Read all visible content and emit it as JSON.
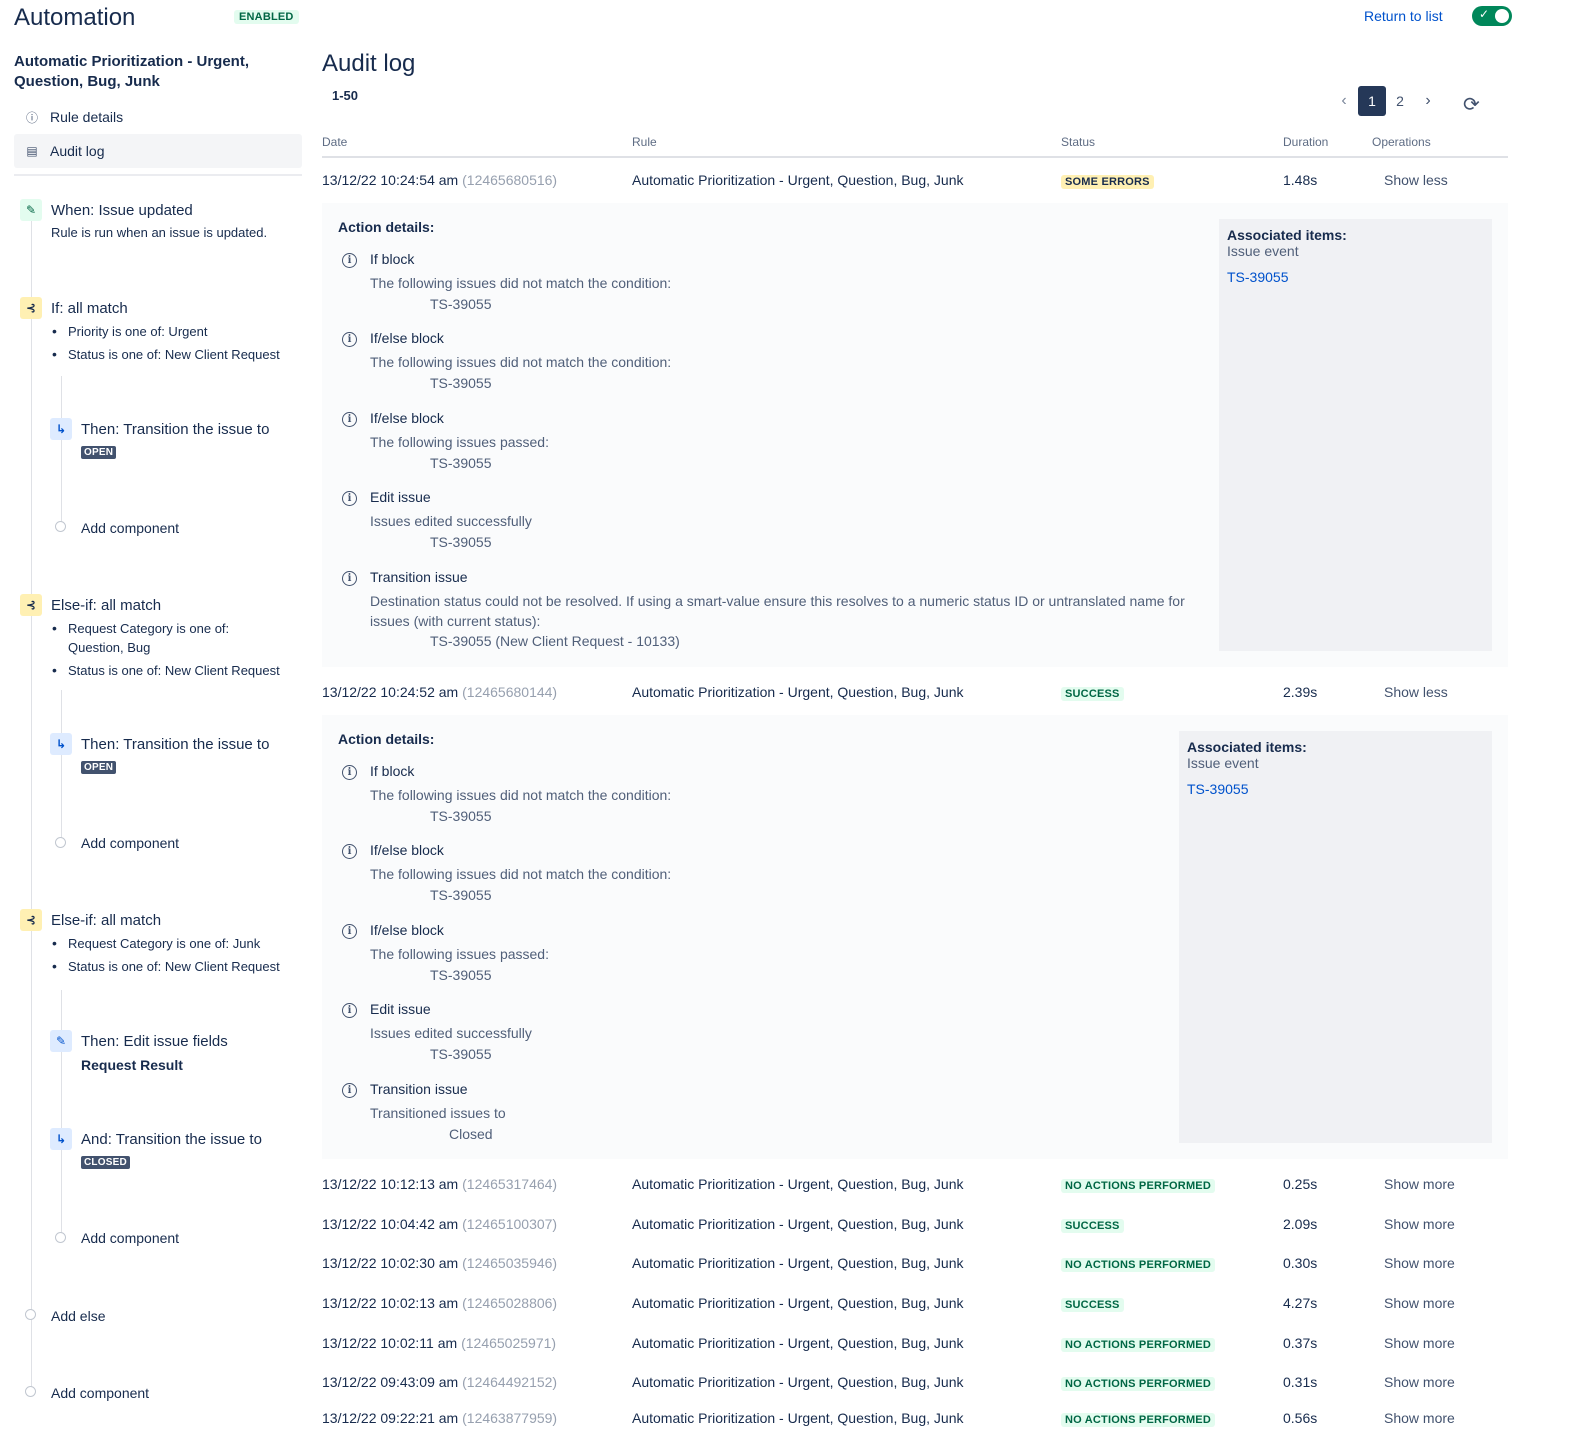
{
  "header": {
    "app_title": "Automation",
    "enabled_badge": "ENABLED",
    "return_link": "Return to list"
  },
  "sidebar": {
    "rule_name": "Automatic Prioritization - Urgent, Question, Bug, Junk",
    "nav": [
      {
        "label": "Rule details",
        "icon": "info-icon"
      },
      {
        "label": "Audit log",
        "icon": "document-icon"
      }
    ]
  },
  "flow": {
    "trigger": {
      "title": "When: Issue updated",
      "subtitle": "Rule is run when an issue is updated."
    },
    "if1": {
      "title": "If: all match",
      "conditions": [
        "Priority is one of: Urgent",
        "Status is one of: New Client Request"
      ]
    },
    "then1": {
      "title": "Then: Transition the issue to",
      "status": "OPEN"
    },
    "add_component": "Add component",
    "elseif1": {
      "title": "Else-if: all match",
      "conditions": [
        "Request Category is one of: Question, Bug",
        "Status is one of: New Client Request"
      ]
    },
    "then2": {
      "title": "Then: Transition the issue to",
      "status": "OPEN"
    },
    "elseif2": {
      "title": "Else-if: all match",
      "conditions": [
        "Request Category is one of: Junk",
        "Status is one of: New Client Request"
      ]
    },
    "then3": {
      "title": "Then: Edit issue fields",
      "field": "Request Result"
    },
    "and1": {
      "title": "And: Transition the issue to",
      "status": "CLOSED"
    },
    "add_else": "Add else"
  },
  "main": {
    "title": "Audit log",
    "range": "1-50",
    "pages": [
      "1",
      "2"
    ],
    "columns": {
      "date": "Date",
      "rule": "Rule",
      "status": "Status",
      "duration": "Duration",
      "operations": "Operations"
    }
  },
  "rows": [
    {
      "date": "13/12/22 10:24:54 am",
      "id": "(12465680516)",
      "rule": "Automatic Prioritization - Urgent, Question, Bug, Junk",
      "status": "SOME ERRORS",
      "duration": "1.48s",
      "op": "Show less"
    },
    {
      "date": "13/12/22 10:24:52 am",
      "id": "(12465680144)",
      "rule": "Automatic Prioritization - Urgent, Question, Bug, Junk",
      "status": "SUCCESS",
      "duration": "2.39s",
      "op": "Show less"
    },
    {
      "date": "13/12/22 10:12:13 am",
      "id": "(12465317464)",
      "rule": "Automatic Prioritization - Urgent, Question, Bug, Junk",
      "status": "NO ACTIONS PERFORMED",
      "duration": "0.25s",
      "op": "Show more"
    },
    {
      "date": "13/12/22 10:04:42 am",
      "id": "(12465100307)",
      "rule": "Automatic Prioritization - Urgent, Question, Bug, Junk",
      "status": "SUCCESS",
      "duration": "2.09s",
      "op": "Show more"
    },
    {
      "date": "13/12/22 10:02:30 am",
      "id": "(12465035946)",
      "rule": "Automatic Prioritization - Urgent, Question, Bug, Junk",
      "status": "NO ACTIONS PERFORMED",
      "duration": "0.30s",
      "op": "Show more"
    },
    {
      "date": "13/12/22 10:02:13 am",
      "id": "(12465028806)",
      "rule": "Automatic Prioritization - Urgent, Question, Bug, Junk",
      "status": "SUCCESS",
      "duration": "4.27s",
      "op": "Show more"
    },
    {
      "date": "13/12/22 10:02:11 am",
      "id": "(12465025971)",
      "rule": "Automatic Prioritization - Urgent, Question, Bug, Junk",
      "status": "NO ACTIONS PERFORMED",
      "duration": "0.37s",
      "op": "Show more"
    },
    {
      "date": "13/12/22 09:43:09 am",
      "id": "(12464492152)",
      "rule": "Automatic Prioritization - Urgent, Question, Bug, Junk",
      "status": "NO ACTIONS PERFORMED",
      "duration": "0.31s",
      "op": "Show more"
    },
    {
      "date": "13/12/22 09:22:21 am",
      "id": "(12463877959)",
      "rule": "Automatic Prioritization - Urgent, Question, Bug, Junk",
      "status": "NO ACTIONS PERFORMED",
      "duration": "0.56s",
      "op": "Show more"
    }
  ],
  "details": [
    {
      "title": "Action details:",
      "actions": [
        {
          "name": "If block",
          "desc": "The following issues did not match the condition:",
          "key": "TS-39055"
        },
        {
          "name": "If/else block",
          "desc": "The following issues did not match the condition:",
          "key": "TS-39055"
        },
        {
          "name": "If/else block",
          "desc": "The following issues passed:",
          "key": "TS-39055"
        },
        {
          "name": "Edit issue",
          "desc": "Issues edited successfully",
          "key": "TS-39055"
        },
        {
          "name": "Transition issue",
          "desc": "Destination status could not be resolved. If using a smart-value ensure this resolves to a numeric status ID or untranslated name for issues (with current status):",
          "key": "TS-39055 (New Client Request - 10133)"
        }
      ],
      "assoc": {
        "title": "Associated items:",
        "sub": "Issue event",
        "link": "TS-39055"
      }
    },
    {
      "title": "Action details:",
      "actions": [
        {
          "name": "If block",
          "desc": "The following issues did not match the condition:",
          "key": "TS-39055"
        },
        {
          "name": "If/else block",
          "desc": "The following issues did not match the condition:",
          "key": "TS-39055"
        },
        {
          "name": "If/else block",
          "desc": "The following issues passed:",
          "key": "TS-39055"
        },
        {
          "name": "Edit issue",
          "desc": "Issues edited successfully",
          "key": "TS-39055"
        },
        {
          "name": "Transition issue",
          "desc": "Transitioned issues to",
          "key": "Closed"
        }
      ],
      "assoc": {
        "title": "Associated items:",
        "sub": "Issue event",
        "link": "TS-39055"
      }
    }
  ],
  "colors": {
    "accent": "#0052cc",
    "success": "#006644",
    "warning_bg": "#fff0b3",
    "nav_dark": "#253858"
  }
}
